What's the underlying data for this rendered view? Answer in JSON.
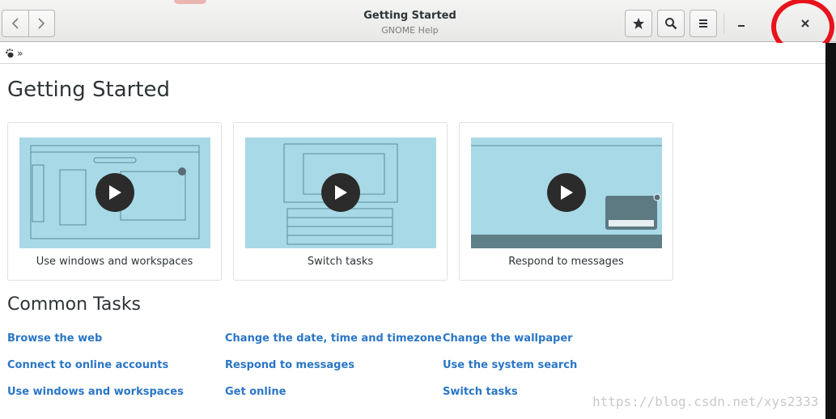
{
  "window": {
    "title": "Getting Started",
    "subtitle": "GNOME Help"
  },
  "header": {
    "back_icon": "chevron-left-icon",
    "forward_icon": "chevron-right-icon",
    "bookmark_icon": "star-icon",
    "search_icon": "search-icon",
    "menu_icon": "hamburger-menu-icon",
    "minimize_icon": "minimize-icon",
    "close_icon": "close-icon"
  },
  "breadcrumb": {
    "home_icon": "gnome-foot-icon",
    "separator": "»"
  },
  "main": {
    "heading": "Getting Started",
    "videos": [
      {
        "label": "Use windows and workspaces"
      },
      {
        "label": "Switch tasks"
      },
      {
        "label": "Respond to messages"
      }
    ],
    "tasks_heading": "Common Tasks",
    "tasks": [
      "Browse the web",
      "Connect to online accounts",
      "Use windows and workspaces",
      "Change the date, time and timezone",
      "Respond to messages",
      "Get online",
      "Change the wallpaper",
      "Use the system search",
      "Switch tasks"
    ]
  },
  "watermark": "https://blog.csdn.net/xys2333",
  "colors": {
    "link": "#2a76c6",
    "thumb": "#a8d9e6",
    "annotation": "#e8131b"
  }
}
